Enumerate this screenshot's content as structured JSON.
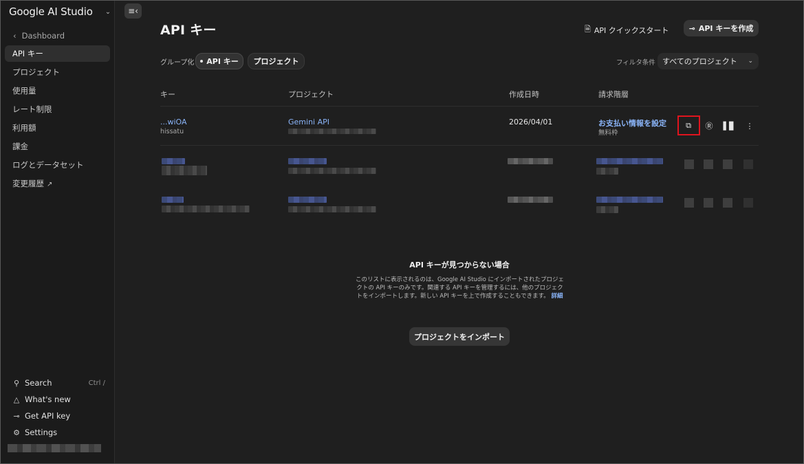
{
  "sidebar": {
    "brand": "Google AI Studio",
    "back_label": "Dashboard",
    "items": [
      {
        "label": "API キー"
      },
      {
        "label": "プロジェクト"
      },
      {
        "label": "使用量"
      },
      {
        "label": "レート制限"
      },
      {
        "label": "利用額"
      },
      {
        "label": "課金"
      },
      {
        "label": "ログとデータセット"
      },
      {
        "label": "変更履歴"
      }
    ],
    "bottom": [
      {
        "label": "Search",
        "shortcut": "Ctrl /"
      },
      {
        "label": "What's new"
      },
      {
        "label": "Get API key"
      },
      {
        "label": "Settings"
      }
    ]
  },
  "header": {
    "title": "API キー",
    "quickstart_label": "API クイックスタート",
    "create_label": "API キーを作成"
  },
  "grouping": {
    "label": "グループ化",
    "options": [
      "API キー",
      "プロジェクト"
    ],
    "selected": "API キー"
  },
  "filter": {
    "label": "フィルタ条件",
    "value": "すべてのプロジェクト"
  },
  "table": {
    "columns": [
      "キー",
      "プロジェクト",
      "作成日時",
      "請求階層"
    ],
    "rows": [
      {
        "key": "...wiOA",
        "key_name": "hissatu",
        "project": "Gemini API",
        "created": "2026/04/01",
        "tier": "お支払い情報を設定",
        "tier_sub": "無料枠"
      }
    ]
  },
  "empty_state": {
    "title": "API キーが見つからない場合",
    "description": "このリストに表示されるのは、Google AI Studio にインポートされたプロジェクトの API キーのみです。関連する API キーを管理するには、他のプロジェクトをインポートします。新しい API キーを上で作成することもできます。",
    "more_link": "詳細",
    "import_label": "プロジェクトをインポート"
  },
  "colors": {
    "accent_link": "#8ab4f8",
    "highlight_box": "#e0141e",
    "background": "#1f1f1f"
  }
}
